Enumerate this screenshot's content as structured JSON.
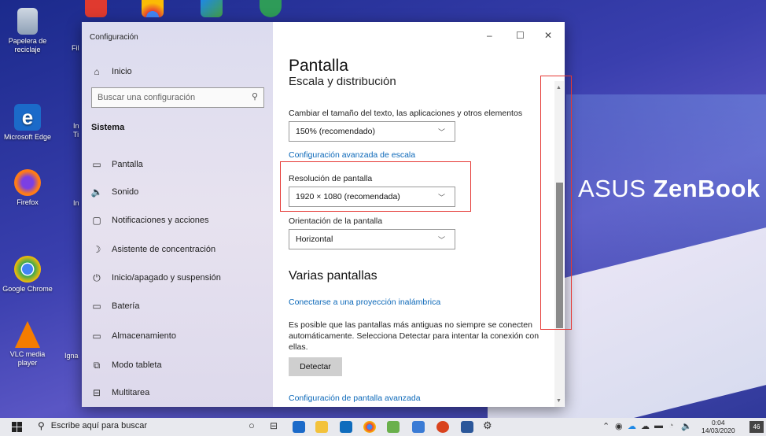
{
  "desktop": {
    "brand_prefix": "ASUS ",
    "brand_name": "ZenBook",
    "icons": [
      {
        "label": "Papelera de reciclaje"
      },
      {
        "label": "Microsoft Edge"
      },
      {
        "label": "Firefox"
      },
      {
        "label": "Google Chrome"
      },
      {
        "label": "VLC media player"
      }
    ],
    "partial_labels": [
      "Fil",
      "In",
      "Ti",
      "In",
      "Igna"
    ]
  },
  "window": {
    "title": "Configuración",
    "controls": {
      "minimize": "–",
      "maximize": "☐",
      "close": "✕"
    }
  },
  "sidebar": {
    "home": "Inicio",
    "search_placeholder": "Buscar una configuración",
    "section": "Sistema",
    "items": [
      {
        "label": "Pantalla",
        "icon": "monitor-icon"
      },
      {
        "label": "Sonido",
        "icon": "speaker-icon"
      },
      {
        "label": "Notificaciones y acciones",
        "icon": "notification-icon"
      },
      {
        "label": "Asistente de concentración",
        "icon": "moon-icon"
      },
      {
        "label": "Inicio/apagado y suspensión",
        "icon": "power-icon"
      },
      {
        "label": "Batería",
        "icon": "battery-icon"
      },
      {
        "label": "Almacenamiento",
        "icon": "storage-icon"
      },
      {
        "label": "Modo tableta",
        "icon": "tablet-icon"
      },
      {
        "label": "Multitarea",
        "icon": "multitask-icon"
      }
    ]
  },
  "main": {
    "page_title": "Pantalla",
    "cut_heading": "Escala y distribución",
    "scale_label": "Cambiar el tamaño del texto, las aplicaciones y otros elementos",
    "scale_value": "150% (recomendado)",
    "advanced_scale_link": "Configuración avanzada de escala",
    "resolution_label": "Resolución de pantalla",
    "resolution_value": "1920 × 1080 (recomendada)",
    "orientation_label": "Orientación de la pantalla",
    "orientation_value": "Horizontal",
    "multi_heading": "Varias pantallas",
    "wireless_link": "Conectarse a una proyección inalámbrica",
    "detect_text": "Es posible que las pantallas más antiguas no siempre se conecten automáticamente. Selecciona Detectar para intentar la conexión con ellas.",
    "detect_button": "Detectar",
    "advanced_display_link": "Configuración de pantalla avanzada"
  },
  "taskbar": {
    "search_placeholder": "Escribe aquí para buscar",
    "time": "0:04",
    "date": "14/03/2020",
    "notifications": "46"
  },
  "colors": {
    "accent_link": "#0a67b8",
    "highlight_box": "#e53935"
  }
}
